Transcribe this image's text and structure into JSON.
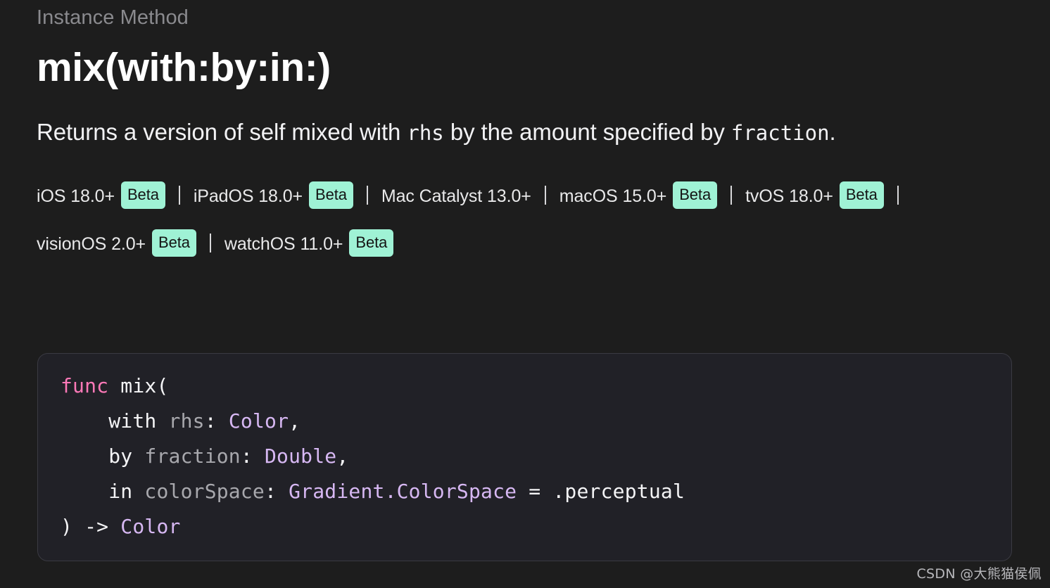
{
  "page": {
    "background_color": "#1d1d1d",
    "eyebrow": "Instance Method",
    "title": "mix(with:by:in:)"
  },
  "abstract": {
    "part1": "Returns a version of self mixed with ",
    "code1": "rhs",
    "part2": " by the amount specified by ",
    "code2": "fraction",
    "part3": "."
  },
  "availability": {
    "beta_badge_color": "#9ff2d5",
    "beta_label": "Beta",
    "platforms": [
      {
        "name": "iOS 18.0+",
        "beta": true
      },
      {
        "name": "iPadOS 18.0+",
        "beta": true
      },
      {
        "name": "Mac Catalyst 13.0+",
        "beta": false
      },
      {
        "name": "macOS 15.0+",
        "beta": true
      },
      {
        "name": "tvOS 18.0+",
        "beta": true
      },
      {
        "name": "visionOS 2.0+",
        "beta": true
      },
      {
        "name": "watchOS 11.0+",
        "beta": true
      }
    ]
  },
  "declaration": {
    "colors": {
      "keyword": "#ff79b8",
      "plain": "#f4f4f6",
      "parameter": "#a8a8ad",
      "type": "#d7b8f3",
      "background": "#212127",
      "border": "#3a3a42"
    },
    "lines": [
      {
        "id": "line1",
        "tokens": [
          {
            "text": "func",
            "kind": "keyword"
          },
          {
            "text": " mix(",
            "kind": "plain"
          }
        ]
      },
      {
        "id": "line2",
        "tokens": [
          {
            "text": "    with ",
            "kind": "plain"
          },
          {
            "text": "rhs",
            "kind": "parameter"
          },
          {
            "text": ": ",
            "kind": "plain"
          },
          {
            "text": "Color",
            "kind": "type"
          },
          {
            "text": ",",
            "kind": "plain"
          }
        ]
      },
      {
        "id": "line3",
        "tokens": [
          {
            "text": "    by ",
            "kind": "plain"
          },
          {
            "text": "fraction",
            "kind": "parameter"
          },
          {
            "text": ": ",
            "kind": "plain"
          },
          {
            "text": "Double",
            "kind": "type"
          },
          {
            "text": ",",
            "kind": "plain"
          }
        ]
      },
      {
        "id": "line4",
        "tokens": [
          {
            "text": "    in ",
            "kind": "plain"
          },
          {
            "text": "colorSpace",
            "kind": "parameter"
          },
          {
            "text": ": ",
            "kind": "plain"
          },
          {
            "text": "Gradient.ColorSpace",
            "kind": "type"
          },
          {
            "text": " = .perceptual",
            "kind": "plain"
          }
        ]
      },
      {
        "id": "line5",
        "tokens": [
          {
            "text": ") -> ",
            "kind": "plain"
          },
          {
            "text": "Color",
            "kind": "type"
          }
        ]
      }
    ]
  },
  "watermark": {
    "text": "CSDN @大熊猫侯佩"
  }
}
